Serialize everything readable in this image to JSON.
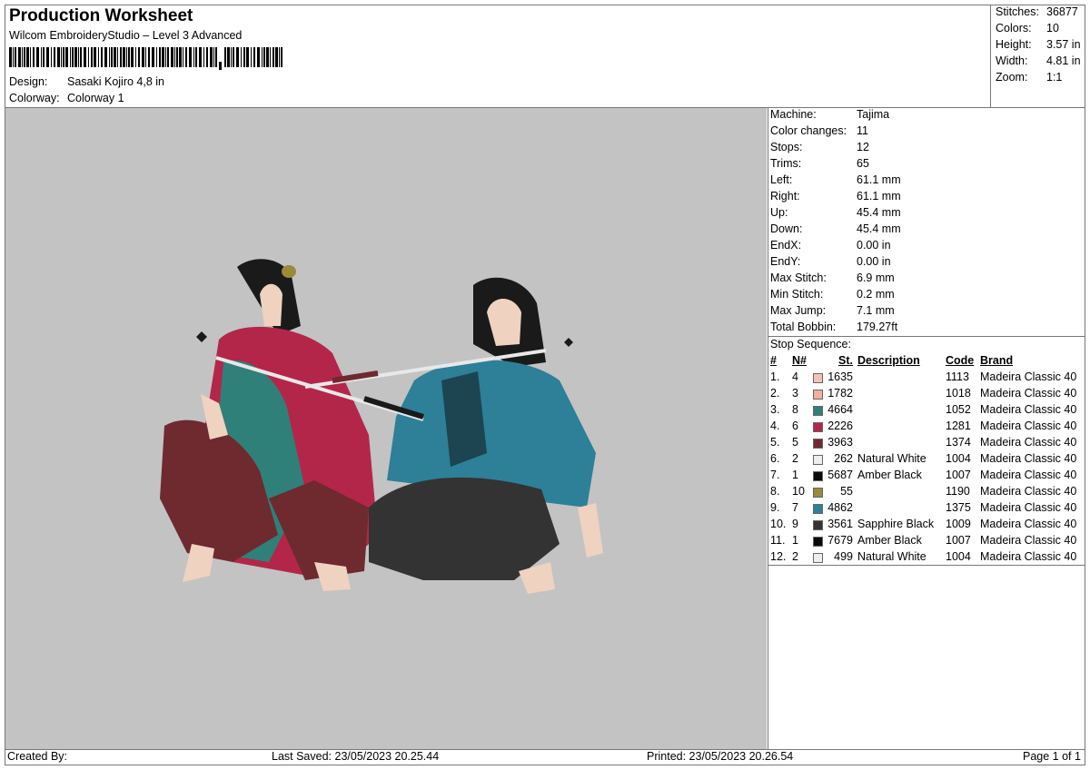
{
  "header": {
    "title": "Production Worksheet",
    "software": "Wilcom EmbroideryStudio – Level 3 Advanced",
    "design_label": "Design:",
    "design_value": "Sasaki Kojiro 4,8 in",
    "colorway_label": "Colorway:",
    "colorway_value": "Colorway 1"
  },
  "stats": [
    {
      "label": "Stitches:",
      "value": "36877"
    },
    {
      "label": "Colors:",
      "value": "10"
    },
    {
      "label": "Height:",
      "value": "3.57 in"
    },
    {
      "label": "Width:",
      "value": "4.81 in"
    },
    {
      "label": "Zoom:",
      "value": "1:1"
    }
  ],
  "machine_info": [
    {
      "label": "Machine:",
      "value": "Tajima"
    },
    {
      "label": "Color changes:",
      "value": "11"
    },
    {
      "label": "Stops:",
      "value": "12"
    },
    {
      "label": "Trims:",
      "value": "65"
    },
    {
      "label": "Left:",
      "value": "61.1 mm"
    },
    {
      "label": "Right:",
      "value": "61.1 mm"
    },
    {
      "label": "Up:",
      "value": "45.4 mm"
    },
    {
      "label": "Down:",
      "value": "45.4 mm"
    },
    {
      "label": "EndX:",
      "value": "0.00 in"
    },
    {
      "label": "EndY:",
      "value": "0.00 in"
    },
    {
      "label": "Max Stitch:",
      "value": "6.9 mm"
    },
    {
      "label": "Min Stitch:",
      "value": "0.2 mm"
    },
    {
      "label": "Max Jump:",
      "value": "7.1 mm"
    },
    {
      "label": "Total Bobbin:",
      "value": "179.27ft"
    }
  ],
  "stop_sequence": {
    "title": "Stop Sequence:",
    "columns": {
      "idx": "#",
      "n": "N#",
      "st": "St.",
      "desc": "Description",
      "code": "Code",
      "brand": "Brand"
    },
    "rows": [
      {
        "idx": "1.",
        "n": "4",
        "color": "#f2c2b6",
        "st": "1635",
        "desc": "",
        "code": "1113",
        "brand": "Madeira Classic 40"
      },
      {
        "idx": "2.",
        "n": "3",
        "color": "#efb0a2",
        "st": "1782",
        "desc": "",
        "code": "1018",
        "brand": "Madeira Classic 40"
      },
      {
        "idx": "3.",
        "n": "8",
        "color": "#2f8079",
        "st": "4664",
        "desc": "",
        "code": "1052",
        "brand": "Madeira Classic 40"
      },
      {
        "idx": "4.",
        "n": "6",
        "color": "#b3264a",
        "st": "2226",
        "desc": "",
        "code": "1281",
        "brand": "Madeira Classic 40"
      },
      {
        "idx": "5.",
        "n": "5",
        "color": "#6e2a2f",
        "st": "3963",
        "desc": "",
        "code": "1374",
        "brand": "Madeira Classic 40"
      },
      {
        "idx": "6.",
        "n": "2",
        "color": "#eeeeee",
        "st": "262",
        "desc": "Natural White",
        "code": "1004",
        "brand": "Madeira Classic 40"
      },
      {
        "idx": "7.",
        "n": "1",
        "color": "#0a0a0a",
        "st": "5687",
        "desc": "Amber Black",
        "code": "1007",
        "brand": "Madeira Classic 40"
      },
      {
        "idx": "8.",
        "n": "10",
        "color": "#9a8a3a",
        "st": "55",
        "desc": "",
        "code": "1190",
        "brand": "Madeira Classic 40"
      },
      {
        "idx": "9.",
        "n": "7",
        "color": "#2e7f98",
        "st": "4862",
        "desc": "",
        "code": "1375",
        "brand": "Madeira Classic 40"
      },
      {
        "idx": "10.",
        "n": "9",
        "color": "#333333",
        "st": "3561",
        "desc": "Sapphire Black",
        "code": "1009",
        "brand": "Madeira Classic 40"
      },
      {
        "idx": "11.",
        "n": "1",
        "color": "#0a0a0a",
        "st": "7679",
        "desc": "Amber Black",
        "code": "1007",
        "brand": "Madeira Classic 40"
      },
      {
        "idx": "12.",
        "n": "2",
        "color": "#eeeeee",
        "st": "499",
        "desc": "Natural White",
        "code": "1004",
        "brand": "Madeira Classic 40"
      }
    ]
  },
  "footer": {
    "created_by": "Created By:",
    "last_saved": "Last Saved: 23/05/2023 20.25.44",
    "printed": "Printed: 23/05/2023 20.26.54",
    "page": "Page 1 of 1"
  },
  "colors": {
    "preview_bg": "#c3c3c3",
    "border": "#777777"
  }
}
